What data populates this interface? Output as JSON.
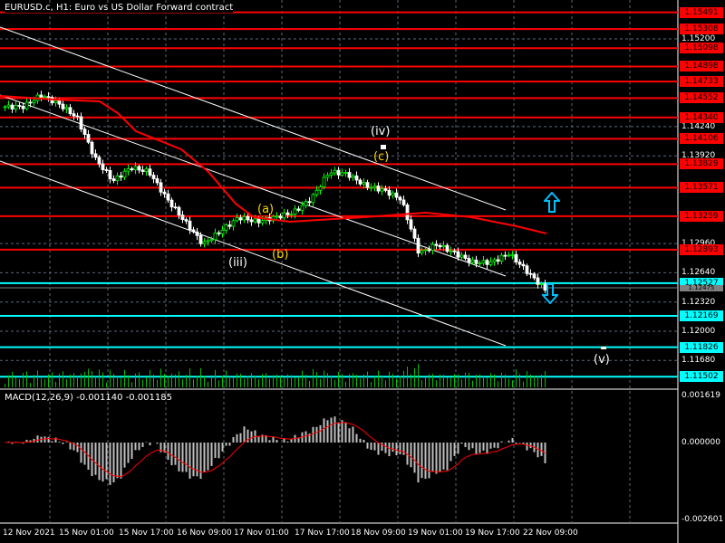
{
  "window": {
    "title": "EURUSD.c, H1:  Euro vs US Dollar Forward contract"
  },
  "macd": {
    "label": "MACD(12,26,9) -0.001140 -0.001185",
    "scale_top": "0.001619",
    "scale_zero": "0.000000",
    "scale_bottom": "-0.002601"
  },
  "price_axis": {
    "ticks": [
      "1.15200",
      "1.14240",
      "1.13920",
      "1.12960",
      "1.12640",
      "1.12320",
      "1.12000",
      "1.11680"
    ],
    "red_levels": [
      "1.15491",
      "1.15308",
      "1.15098",
      "1.14898",
      "1.14733",
      "1.14552",
      "1.14340",
      "1.14106",
      "1.13829",
      "1.13571",
      "1.13259",
      "1.12893"
    ],
    "cyan_levels": [
      "1.12527",
      "1.12169",
      "1.11826",
      "1.11502"
    ],
    "current_price": "1.12475"
  },
  "time_axis": [
    "12 Nov 2021",
    "15 Nov 01:00",
    "15 Nov 17:00",
    "16 Nov 09:00",
    "17 Nov 01:00",
    "17 Nov 17:00",
    "18 Nov 09:00",
    "19 Nov 01:00",
    "19 Nov 17:00",
    "22 Nov 09:00"
  ],
  "waves": {
    "iv": "(iv)",
    "c": "(c)",
    "a": "(a)",
    "b": "(b)",
    "iii": "(iii)",
    "v": "(v)"
  },
  "icons": {
    "up": "arrow-up-icon",
    "down": "arrow-down-icon"
  },
  "colors": {
    "red_level": "#ff0000",
    "cyan_level": "#00ffff",
    "bull": "#00ff00",
    "bear": "#ffffff",
    "ma": "#ff0000",
    "wave_yellow": "#ffd700"
  },
  "chart_data": {
    "type": "candlestick",
    "symbol": "EURUSD.c",
    "timeframe": "H1",
    "close_keypoints": [
      1.14457,
      1.14457,
      1.14586,
      1.14487,
      1.14338,
      1.13892,
      1.13645,
      1.13793,
      1.13744,
      1.13446,
      1.13199,
      1.12951,
      1.131,
      1.13248,
      1.13199,
      1.13248,
      1.13298,
      1.13446,
      1.13744,
      1.13724,
      1.13595,
      1.13546,
      1.13446,
      1.12852,
      1.12951,
      1.12852,
      1.12753,
      1.12753,
      1.12852,
      1.12654,
      1.12456
    ],
    "ylim": [
      1.1145,
      1.156
    ]
  }
}
